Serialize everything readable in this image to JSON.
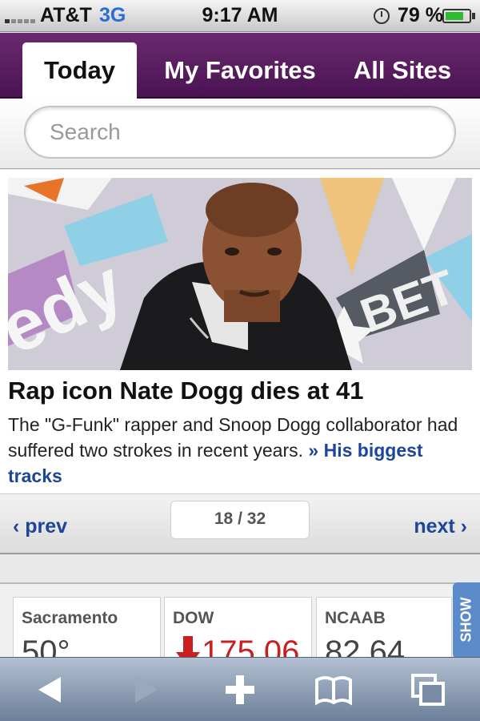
{
  "status_bar": {
    "carrier": "AT&T",
    "network": "3G",
    "time": "9:17 AM",
    "battery_percent": "79 %",
    "battery_level": 0.79
  },
  "tabs": [
    {
      "label": "Today",
      "active": true
    },
    {
      "label": "My Favorites",
      "active": false
    },
    {
      "label": "All Sites",
      "active": false
    }
  ],
  "search": {
    "placeholder": "Search"
  },
  "article": {
    "headline": "Rap icon Nate Dogg dies at 41",
    "summary": "The \"G-Funk\" rapper and Snoop Dogg collaborator had suffered two strokes in recent years.",
    "link_text": "His biggest tracks",
    "link_marker": "»"
  },
  "pager": {
    "prev_label": "prev",
    "next_label": "next",
    "current": "18",
    "total": "32",
    "separator": "/"
  },
  "widgets": [
    {
      "label": "Sacramento",
      "value": "50°"
    },
    {
      "label": "DOW",
      "value": "175.06"
    },
    {
      "label": "NCAAB",
      "value": "82 64"
    }
  ],
  "show_tab_label": "SHOW",
  "colors": {
    "brand_purple": "#4a1352",
    "link_blue": "#1d4699",
    "down_red": "#c82020",
    "show_tab_blue": "#5b8cc9"
  },
  "toolbar": {
    "icons": [
      "back-icon",
      "forward-icon",
      "add-icon",
      "bookmarks-icon",
      "pages-icon"
    ]
  }
}
